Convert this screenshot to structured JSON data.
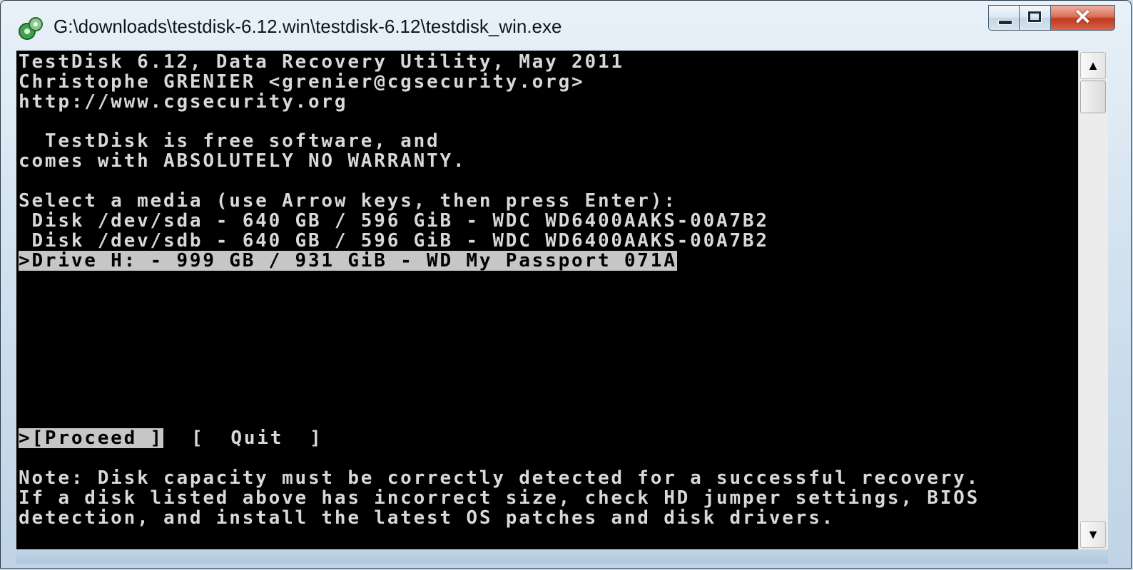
{
  "window": {
    "title": "G:\\downloads\\testdisk-6.12.win\\testdisk-6.12\\testdisk_win.exe",
    "icon": "testdisk-app-icon",
    "controls": {
      "minimize_icon": "minimize-icon",
      "maximize_icon": "maximize-icon",
      "close_icon": "close-icon",
      "close_glyph": "✕"
    }
  },
  "console": {
    "header": [
      "TestDisk 6.12, Data Recovery Utility, May 2011",
      "Christophe GRENIER <grenier@cgsecurity.org>",
      "http://www.cgsecurity.org"
    ],
    "license": [
      "  TestDisk is free software, and",
      "comes with ABSOLUTELY NO WARRANTY."
    ],
    "prompt": "Select a media (use Arrow keys, then press Enter):",
    "media": [
      " Disk /dev/sda - 640 GB / 596 GiB - WDC WD6400AAKS-00A7B2",
      " Disk /dev/sdb - 640 GB / 596 GiB - WDC WD6400AAKS-00A7B2",
      ">Drive H: - 999 GB / 931 GiB - WD My Passport 071A"
    ],
    "selected_media_index": 2,
    "actions": {
      "proceed": ">[Proceed ]",
      "quit": "[  Quit  ]",
      "selected": "proceed"
    },
    "note": [
      "Note: Disk capacity must be correctly detected for a successful recovery.",
      "If a disk listed above has incorrect size, check HD jumper settings, BIOS",
      "detection, and install the latest OS patches and disk drivers."
    ],
    "colors": {
      "background": "#000000",
      "text": "#d8d8d8",
      "highlight_bg": "#c6c6c6",
      "highlight_text": "#000000"
    }
  },
  "scrollbar": {
    "up_arrow": "▲",
    "down_arrow": "▼"
  }
}
